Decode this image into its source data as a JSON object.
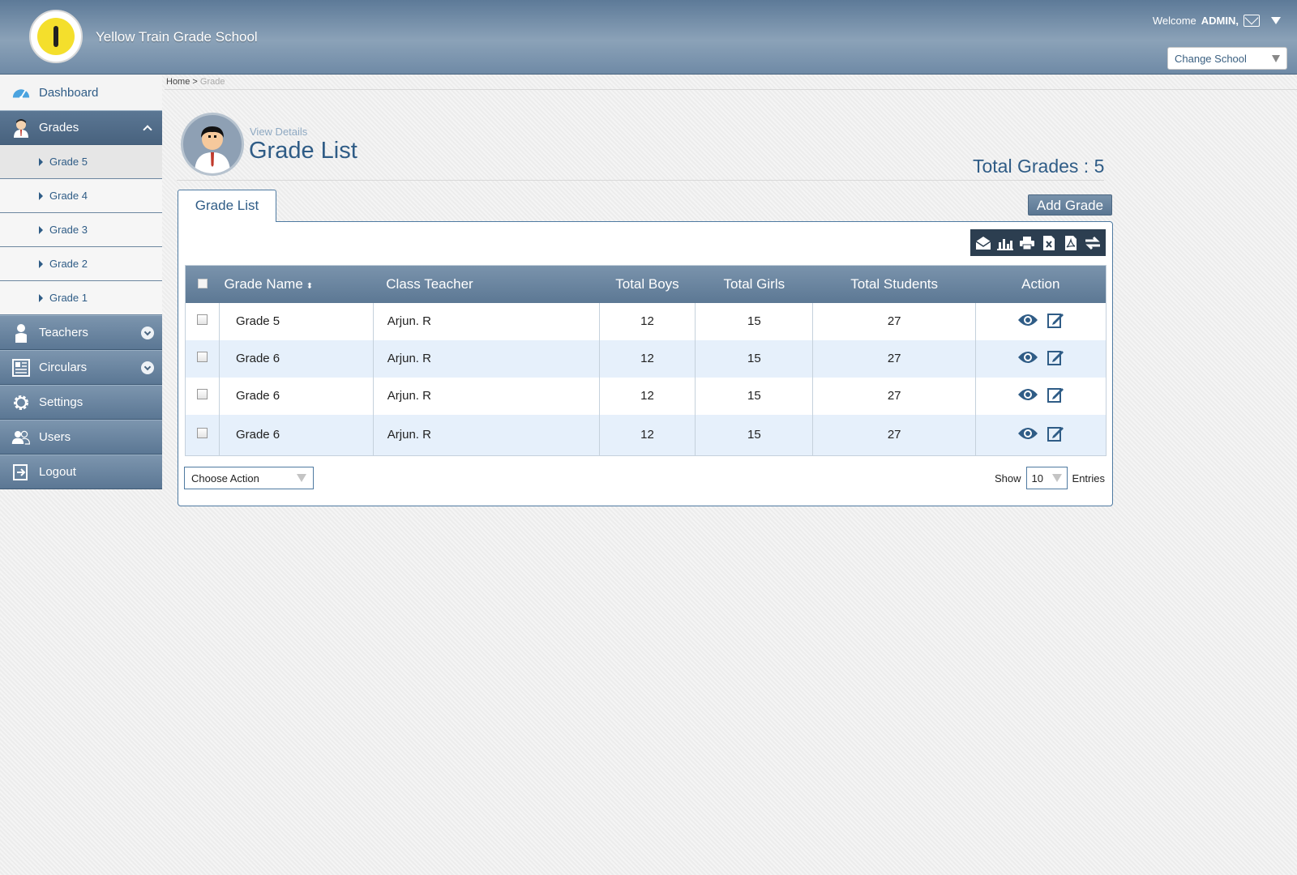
{
  "header": {
    "school_name": "Yellow Train Grade School",
    "logo_text": "Yellow Train",
    "welcome_prefix": "Welcome",
    "user": "ADMIN,",
    "change_school": "Change School"
  },
  "breadcrumb": {
    "home": "Home",
    "separator": ">",
    "current": "Grade"
  },
  "sidebar": {
    "dashboard": "Dashboard",
    "grades": "Grades",
    "grade_items": [
      "Grade 5",
      "Grade 4",
      "Grade 3",
      "Grade 2",
      "Grade 1"
    ],
    "teachers": "Teachers",
    "circulars": "Circulars",
    "settings": "Settings",
    "users": "Users",
    "logout": "Logout"
  },
  "page": {
    "view_details": "View Details",
    "title": "Grade List",
    "total_grades": "Total Grades : 5",
    "tab": "Grade List",
    "add_grade": "Add Grade"
  },
  "toolbar": {
    "icons": [
      "email-icon",
      "chart-icon",
      "print-icon",
      "excel-icon",
      "pdf-icon",
      "refresh-icon"
    ]
  },
  "table": {
    "columns": [
      "Grade Name",
      "Class Teacher",
      "Total Boys",
      "Total Girls",
      "Total Students",
      "Action"
    ],
    "rows": [
      {
        "grade": "Grade 5",
        "teacher": "Arjun. R",
        "boys": "12",
        "girls": "15",
        "students": "27"
      },
      {
        "grade": "Grade 6",
        "teacher": "Arjun. R",
        "boys": "12",
        "girls": "15",
        "students": "27"
      },
      {
        "grade": "Grade 6",
        "teacher": "Arjun. R",
        "boys": "12",
        "girls": "15",
        "students": "27"
      },
      {
        "grade": "Grade 6",
        "teacher": "Arjun. R",
        "boys": "12",
        "girls": "15",
        "students": "27"
      }
    ]
  },
  "footer": {
    "choose_action": "Choose Action",
    "show": "Show",
    "entries_value": "10",
    "entries": "Entries"
  },
  "colors": {
    "accent": "#2f5c86",
    "header_bg": "#7a93ac",
    "row_alt": "#e6f0fb"
  }
}
